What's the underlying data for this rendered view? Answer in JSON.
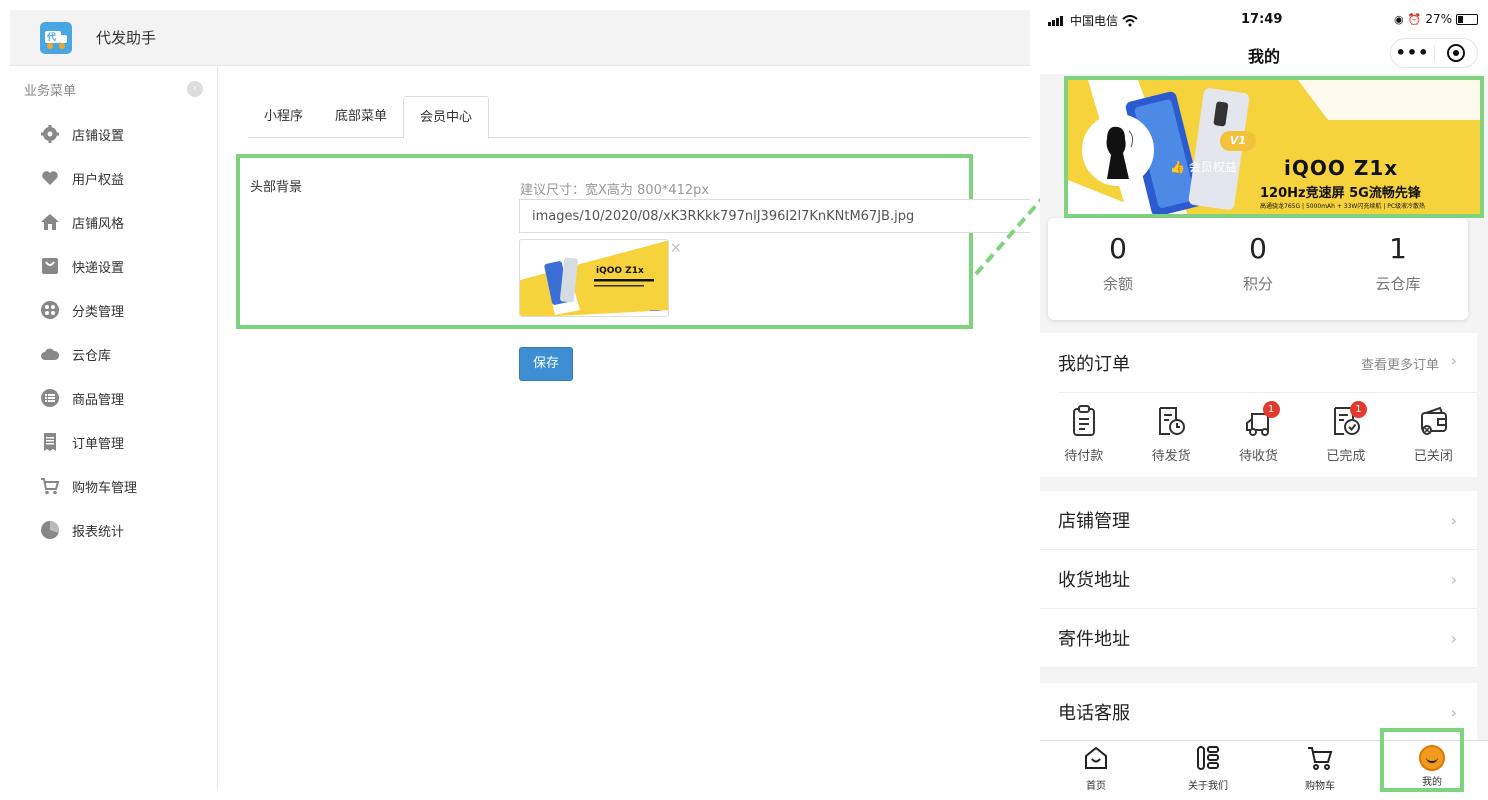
{
  "admin": {
    "title": "代发助手",
    "logo_char": "代",
    "sidebar": {
      "header": "业务菜单",
      "collapse_glyph": "‹",
      "items": [
        {
          "label": "店铺设置",
          "icon": "gear-icon"
        },
        {
          "label": "用户权益",
          "icon": "heart-icon"
        },
        {
          "label": "店铺风格",
          "icon": "home-icon"
        },
        {
          "label": "快递设置",
          "icon": "bag-icon"
        },
        {
          "label": "分类管理",
          "icon": "grid-icon"
        },
        {
          "label": "云仓库",
          "icon": "cloud-icon"
        },
        {
          "label": "商品管理",
          "icon": "list-icon"
        },
        {
          "label": "订单管理",
          "icon": "receipt-icon"
        },
        {
          "label": "购物车管理",
          "icon": "cart-icon"
        },
        {
          "label": "报表统计",
          "icon": "pie-chart-icon"
        }
      ]
    },
    "tabs": [
      {
        "label": "小程序",
        "active": false
      },
      {
        "label": "底部菜单",
        "active": false
      },
      {
        "label": "会员中心",
        "active": true
      }
    ],
    "form": {
      "label": "头部背景",
      "hint": "建议尺寸：宽X高为 800*412px",
      "path_value": "images/10/2020/08/xK3RKkk797nlJ396I2l7KnKNtM67JB.jpg",
      "thumb_close": "×",
      "save_label": "保存"
    }
  },
  "phone": {
    "status": {
      "carrier": "中国电信",
      "time": "17:49",
      "battery": "27%"
    },
    "nav_title": "我的",
    "capsule_dots": "•••",
    "banner": {
      "vip": "V1",
      "member_text": "会员权益",
      "brand": "iQOO Z1x",
      "sub1": "120Hz竞速屏 5G流畅先锋",
      "sub2": "高通骁龙765G | 5000mAh + 33W闪充续航 | PC级液冷散热"
    },
    "stats": [
      {
        "value": "0",
        "label": "余额"
      },
      {
        "value": "0",
        "label": "积分"
      },
      {
        "value": "1",
        "label": "云仓库"
      }
    ],
    "orders": {
      "title": "我的订单",
      "more": "查看更多订单",
      "chevron": "›",
      "items": [
        {
          "label": "待付款",
          "badge": ""
        },
        {
          "label": "待发货",
          "badge": ""
        },
        {
          "label": "待收货",
          "badge": "1"
        },
        {
          "label": "已完成",
          "badge": "1"
        },
        {
          "label": "已关闭",
          "badge": ""
        }
      ]
    },
    "list1": [
      "店铺管理",
      "收货地址",
      "寄件地址"
    ],
    "list2": [
      "电话客服"
    ],
    "tabbar": [
      {
        "label": "首页",
        "icon": "home-icon"
      },
      {
        "label": "关于我们",
        "icon": "about-icon"
      },
      {
        "label": "购物车",
        "icon": "cart-icon"
      },
      {
        "label": "我的",
        "icon": "smile-icon"
      }
    ]
  },
  "colors": {
    "highlight": "#7fd37f",
    "primary_button": "#3d8fd1",
    "banner_yellow": "#f6d23c",
    "badge_red": "#e33a30",
    "tab_active_orange": "#f29a1f"
  }
}
